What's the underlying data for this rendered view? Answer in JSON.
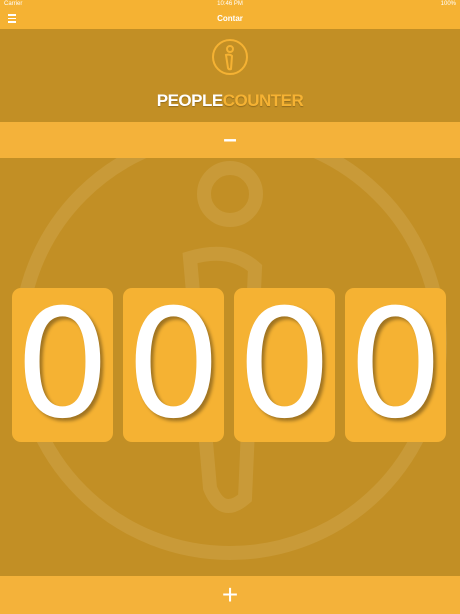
{
  "status_bar": {
    "carrier": "Carrier",
    "time": "10:46 PM",
    "battery": "100%"
  },
  "nav": {
    "title": "Contar"
  },
  "logo": {
    "word_white": "PEOPLE",
    "word_orange": "COUNTER"
  },
  "controls": {
    "decrement": "–",
    "increment": "+"
  },
  "counter": {
    "digits": [
      "0",
      "0",
      "0",
      "0"
    ]
  },
  "colors": {
    "accent": "#f5b233",
    "background": "#c28f25",
    "text": "#ffffff"
  },
  "icons": {
    "menu": "hamburger-menu-icon",
    "logo": "person-in-circle-icon"
  }
}
